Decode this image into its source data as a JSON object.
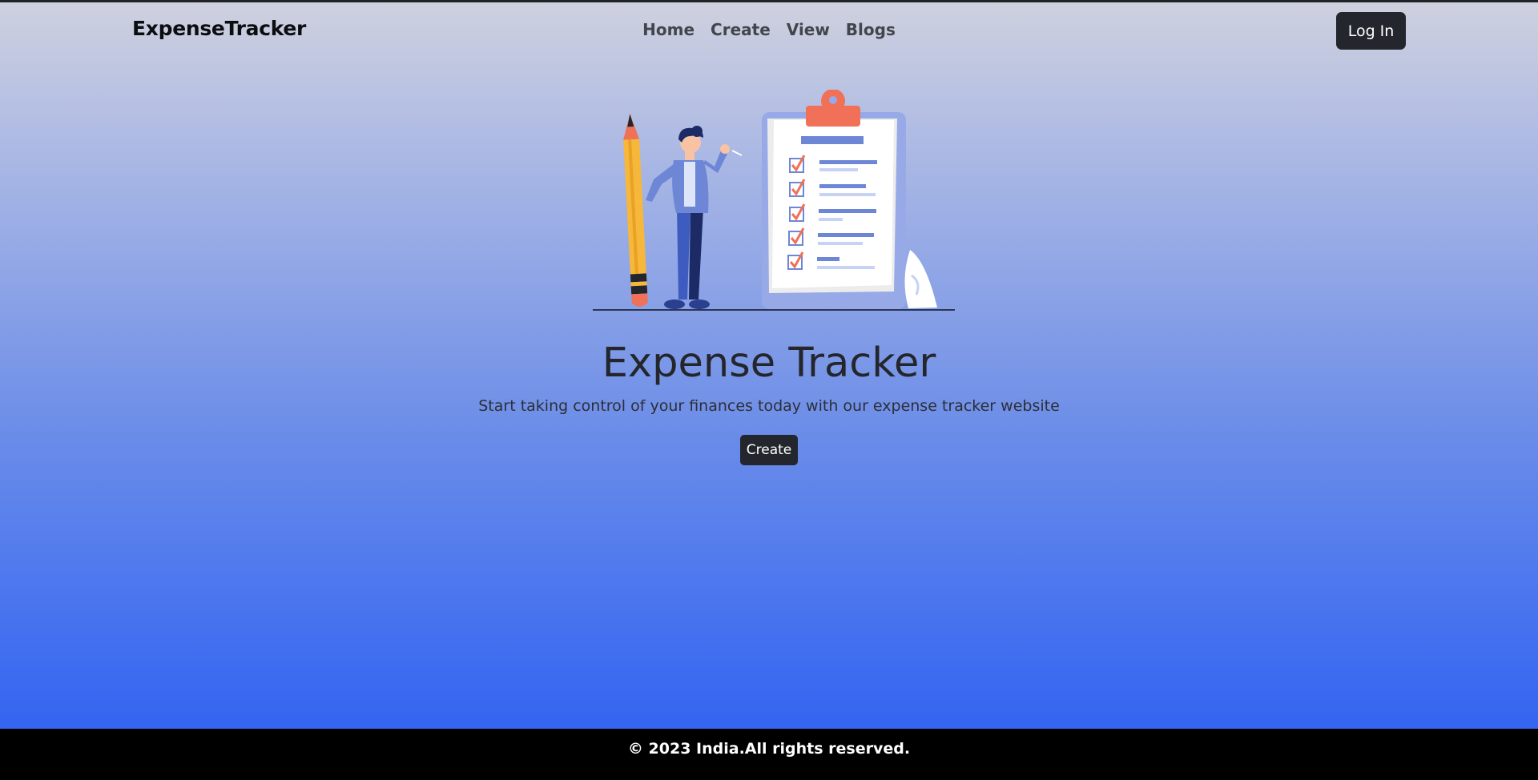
{
  "navbar": {
    "brand": "ExpenseTracker",
    "links": [
      {
        "label": "Home"
      },
      {
        "label": "Create"
      },
      {
        "label": "View"
      },
      {
        "label": "Blogs"
      }
    ],
    "login_label": "Log In"
  },
  "hero": {
    "title": "Expense Tracker",
    "subtitle": "Start taking control of your finances today with our expense tracker website",
    "cta_label": "Create"
  },
  "footer": {
    "text": "© 2023 India.All rights reserved."
  },
  "colors": {
    "button_bg": "#23262c",
    "gradient_top": "#cfd1de",
    "gradient_bottom": "#2c5ef2",
    "footer_bg": "#000000",
    "illustration_accent": "#f07157",
    "illustration_primary": "#6e86d6"
  },
  "icons": [
    "checkbox-checked-icon"
  ]
}
